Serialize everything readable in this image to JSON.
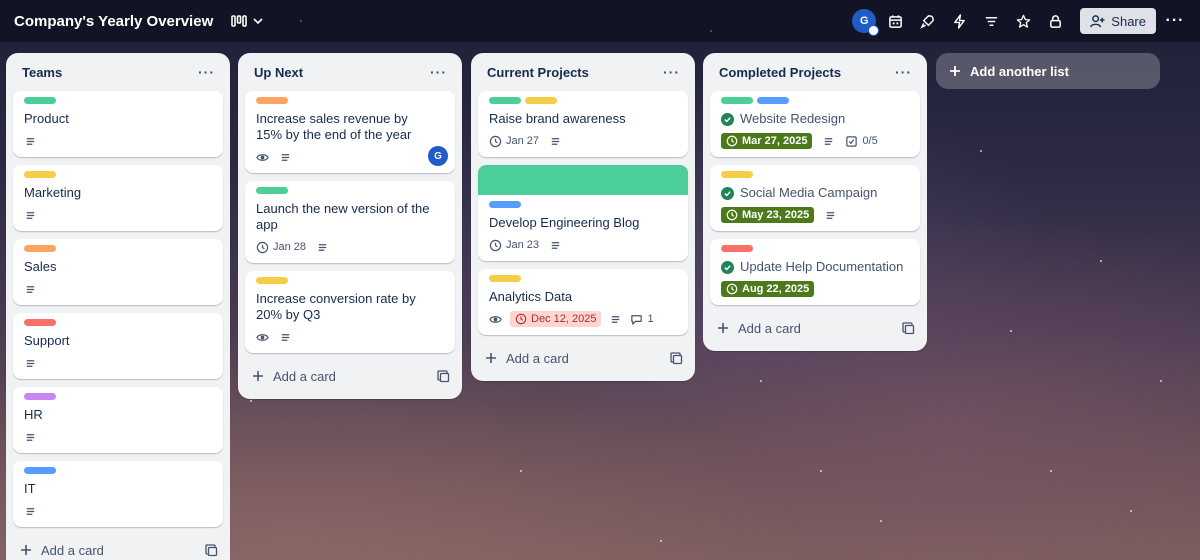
{
  "board": {
    "title": "Company's Yearly Overview",
    "view_icon": "board-view-icon",
    "member_initial": "G",
    "share_label": "Share",
    "add_list_label": "Add another list"
  },
  "colors": {
    "green": "#4bce97",
    "yellow": "#f5cd47",
    "orange": "#fea362",
    "red": "#f87168",
    "purple": "#c785f0",
    "blue": "#579dff"
  },
  "lists": [
    {
      "title": "Teams",
      "add_label": "Add a card",
      "cards": [
        {
          "title": "Product",
          "labels": [
            "green"
          ]
        },
        {
          "title": "Marketing",
          "labels": [
            "yellow"
          ]
        },
        {
          "title": "Sales",
          "labels": [
            "orange"
          ]
        },
        {
          "title": "Support",
          "labels": [
            "red"
          ]
        },
        {
          "title": "HR",
          "labels": [
            "purple"
          ]
        },
        {
          "title": "IT",
          "labels": [
            "blue"
          ]
        }
      ]
    },
    {
      "title": "Up Next",
      "add_label": "Add a card",
      "cards": [
        {
          "title": "Increase sales revenue by 15% by the end of the year",
          "labels": [
            "orange"
          ],
          "member": "G"
        },
        {
          "title": "Launch the new version of the app",
          "labels": [
            "green"
          ],
          "date": "Jan 28"
        },
        {
          "title": "Increase conversion rate by 20% by Q3",
          "labels": [
            "yellow"
          ]
        }
      ]
    },
    {
      "title": "Current Projects",
      "add_label": "Add a card",
      "cards": [
        {
          "title": "Raise brand awareness",
          "labels": [
            "green",
            "yellow"
          ],
          "date": "Jan 27"
        },
        {
          "title": "Develop Engineering Blog",
          "labels": [
            "blue"
          ],
          "date": "Jan 23"
        },
        {
          "title": "Analytics Data",
          "labels": [
            "yellow"
          ],
          "due": "Dec 12, 2025",
          "comments": "1"
        }
      ]
    },
    {
      "title": "Completed Projects",
      "add_label": "Add a card",
      "cards": [
        {
          "title": "Website Redesign",
          "labels": [
            "green",
            "blue"
          ],
          "done_date": "Mar 27, 2025",
          "checklist": "0/5"
        },
        {
          "title": "Social Media Campaign",
          "labels": [
            "yellow"
          ],
          "done_date": "May 23, 2025"
        },
        {
          "title": "Update Help Documentation",
          "labels": [
            "red"
          ],
          "done_date": "Aug 22, 2025"
        }
      ]
    }
  ]
}
